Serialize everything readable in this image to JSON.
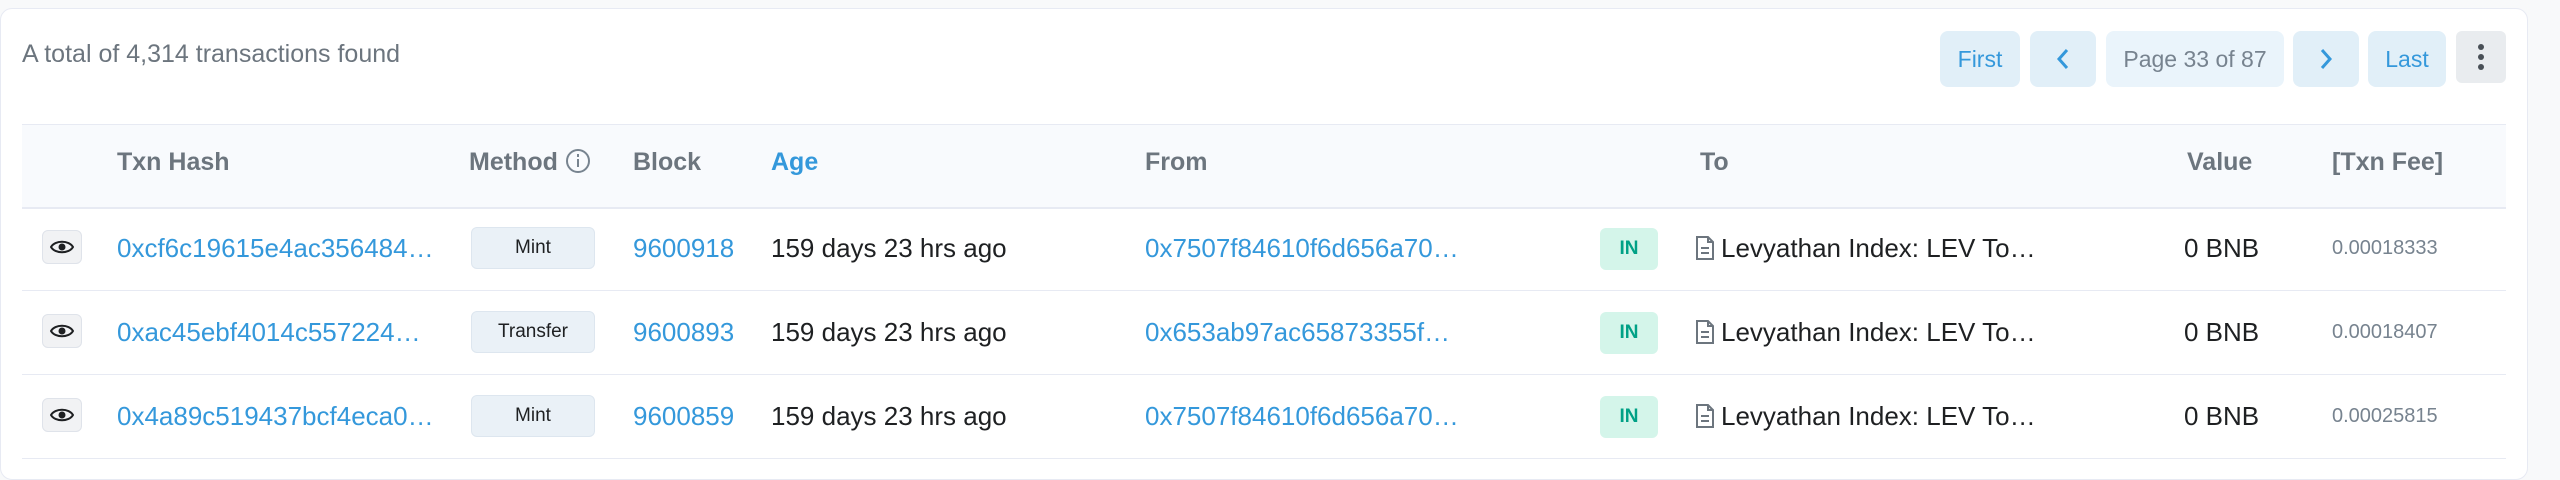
{
  "summary": "A total of 4,314 transactions found",
  "pagination": {
    "first": "First",
    "prev": "‹",
    "page_info": "Page 33 of 87",
    "next": "›",
    "last": "Last"
  },
  "columns": [
    "Txn Hash",
    "Method",
    "Block",
    "Age",
    "From",
    "To",
    "Value",
    "[Txn Fee]"
  ],
  "rows": [
    {
      "hash": "0xcf6c19615e4ac356484…",
      "method": "Mint",
      "block": "9600918",
      "age": "159 days 23 hrs ago",
      "from": "0x7507f84610f6d656a70…",
      "direction": "IN",
      "to": "Levyathan Index: LEV To…",
      "value": "0 BNB",
      "fee": "0.00018333"
    },
    {
      "hash": "0xac45ebf4014c557224…",
      "method": "Transfer",
      "block": "9600893",
      "age": "159 days 23 hrs ago",
      "from": "0x653ab97ac65873355f…",
      "direction": "IN",
      "to": "Levyathan Index: LEV To…",
      "value": "0 BNB",
      "fee": "0.00018407"
    },
    {
      "hash": "0x4a89c519437bcf4eca0…",
      "method": "Mint",
      "block": "9600859",
      "age": "159 days 23 hrs ago",
      "from": "0x7507f84610f6d656a70…",
      "direction": "IN",
      "to": "Levyathan Index: LEV To…",
      "value": "0 BNB",
      "fee": "0.00025815"
    }
  ],
  "colors": {
    "link": "#3498db",
    "in_badge_bg": "#d4f5ea",
    "in_badge_text": "#00a186",
    "muted": "#6c757e"
  },
  "icons": {
    "view": "eye-icon",
    "method_info": "info-icon",
    "contract": "document-icon",
    "more": "more-vertical-icon"
  }
}
